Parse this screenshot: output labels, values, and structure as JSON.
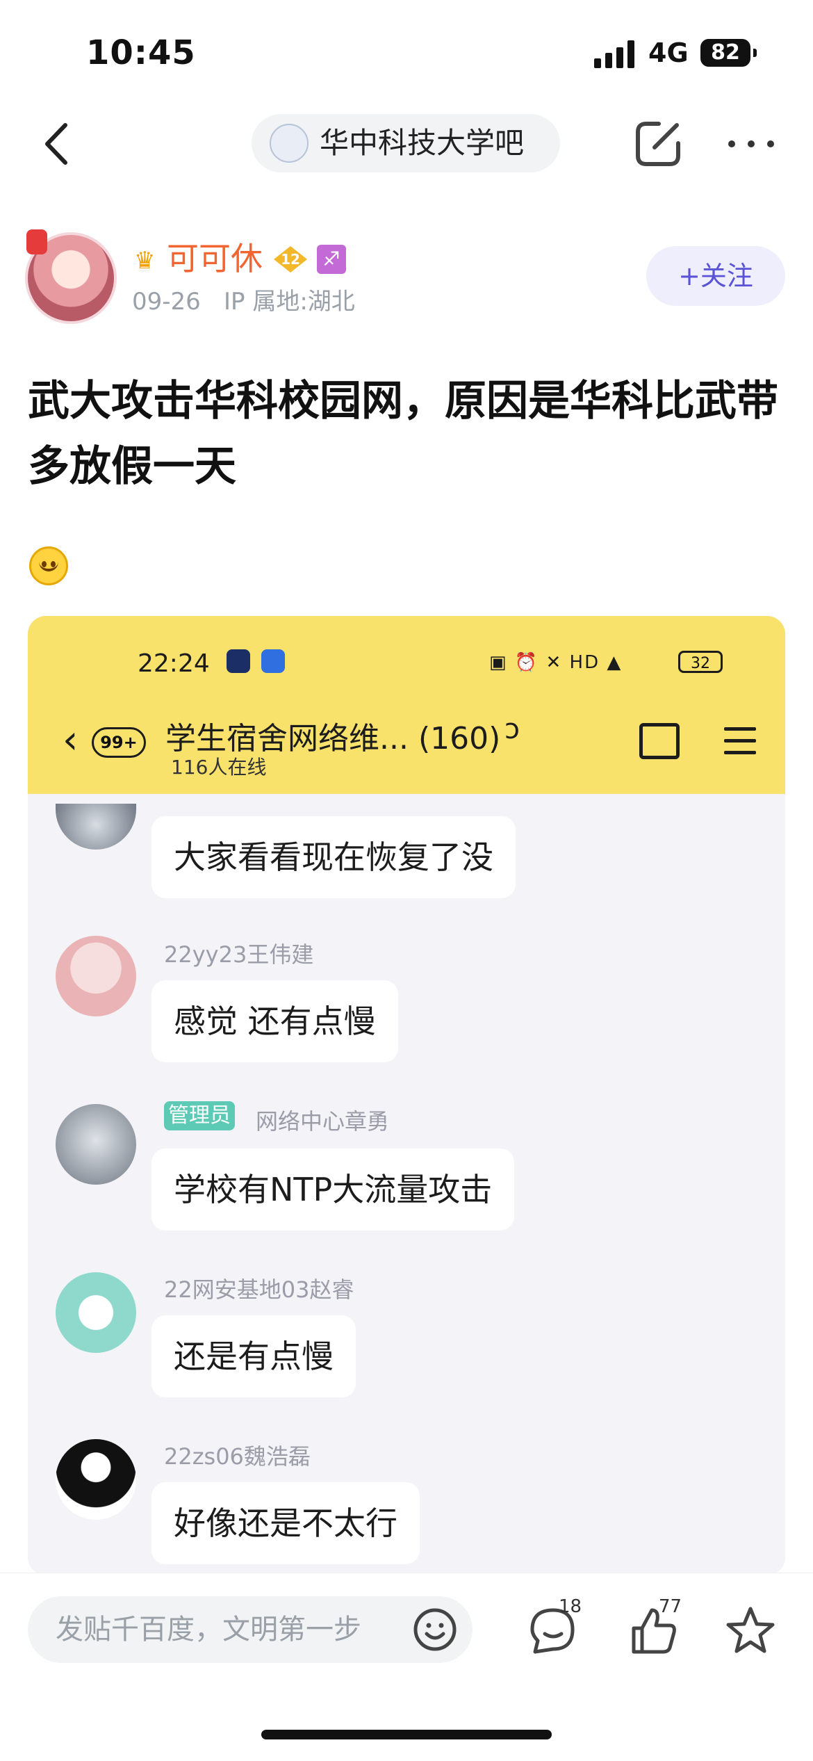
{
  "status_bar": {
    "time": "10:45",
    "network": "4G",
    "battery": "82"
  },
  "nav": {
    "forum_name": "华中科技大学吧"
  },
  "author": {
    "name": "可可休",
    "level": "12",
    "date": "09-26",
    "ip": "IP 属地:湖北",
    "follow_label": "+关注"
  },
  "post": {
    "title": "武大攻击华科校园网，原因是华科比武带多放假一天"
  },
  "embedded": {
    "time": "22:24",
    "battery": "32",
    "unread": "99+",
    "group_name": "学生宿舍网络维... (160)",
    "online": "116人在线",
    "messages": [
      {
        "name": "",
        "text": "大家看看现在恢复了没"
      },
      {
        "name": "22yy23王伟建",
        "text": "感觉  还有点慢"
      },
      {
        "tag": "管理员",
        "name": "网络中心章勇",
        "text": "学校有NTP大流量攻击"
      },
      {
        "name": "22网安基地03赵睿",
        "text": "还是有点慢"
      },
      {
        "name": "22zs06魏浩磊",
        "text": "好像还是不太行"
      }
    ]
  },
  "bottom": {
    "placeholder": "发贴千百度，文明第一步",
    "comment_count": "18",
    "like_count": "77"
  },
  "colors": {
    "username": "#f26431",
    "follow": "#5b53d6",
    "embedded_header": "#f8e26b",
    "admin_tag": "#5ccab5"
  },
  "icons": [
    "back-icon",
    "share-icon",
    "more-icon",
    "crown-icon",
    "level-badge-icon",
    "zodiac-icon",
    "smile-emoji-icon",
    "emoji-icon",
    "comment-icon",
    "like-icon",
    "star-icon"
  ]
}
